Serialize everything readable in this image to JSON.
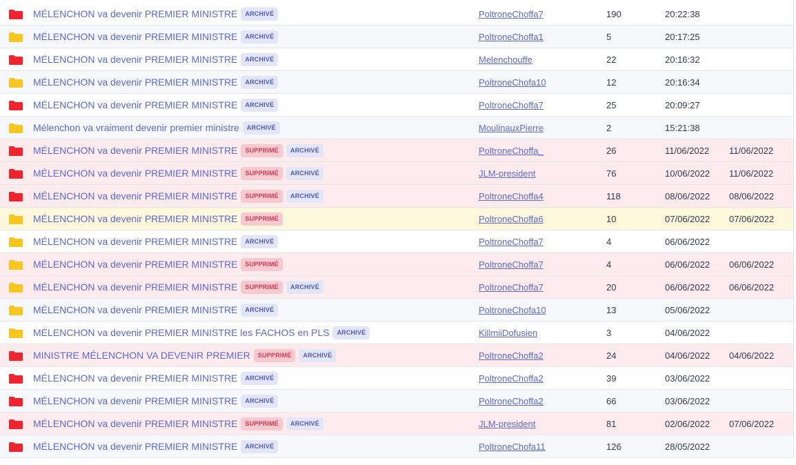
{
  "colors": {
    "folder_red": "#f0252e",
    "folder_yellow": "#f9c51e",
    "link": "#5b6ad0",
    "deleted_row": "#fdebee",
    "highlight_row": "#fdf7dc"
  },
  "labels": {
    "archived": "ARCHIVÉ",
    "deleted": "SUPPRIMÉ"
  },
  "topics": [
    {
      "title": "MÉLENCHON va devenir PREMIER MINISTRE",
      "folder": "red",
      "deleted": false,
      "archived": true,
      "bg": "white",
      "author": "PoltroneChoffa7",
      "replies": "190",
      "date": "20:22:38",
      "deleted_date": ""
    },
    {
      "title": "MÉLENCHON va devenir PREMIER MINISTRE",
      "folder": "yellow",
      "deleted": false,
      "archived": true,
      "bg": "alt",
      "author": "PoltroneChoffa1",
      "replies": "5",
      "date": "20:17:25",
      "deleted_date": ""
    },
    {
      "title": "MÉLENCHON va devenir PREMIER MINISTRE",
      "folder": "red",
      "deleted": false,
      "archived": true,
      "bg": "white",
      "author": "Melenchouffe",
      "replies": "22",
      "date": "20:16:32",
      "deleted_date": ""
    },
    {
      "title": "MÉLENCHON va devenir PREMIER MINISTRE",
      "folder": "yellow",
      "deleted": false,
      "archived": true,
      "bg": "alt",
      "author": "PoltroneChofa10",
      "replies": "12",
      "date": "20:16:34",
      "deleted_date": ""
    },
    {
      "title": "MÉLENCHON va devenir PREMIER MINISTRE",
      "folder": "red",
      "deleted": false,
      "archived": true,
      "bg": "white",
      "author": "PoltroneChoffa7",
      "replies": "25",
      "date": "20:09:27",
      "deleted_date": ""
    },
    {
      "title": "Mélenchon va vraiment devenir premier ministre",
      "folder": "yellow",
      "deleted": false,
      "archived": true,
      "bg": "alt",
      "author": "MoulinauxPierre",
      "replies": "2",
      "date": "15:21:38",
      "deleted_date": ""
    },
    {
      "title": "MÉLENCHON va devenir PREMIER MINISTRE",
      "folder": "red",
      "deleted": true,
      "archived": true,
      "bg": "deleted",
      "author": "PoltroneChoffa_",
      "replies": "26",
      "date": "11/06/2022",
      "deleted_date": "11/06/2022"
    },
    {
      "title": "MÉLENCHON va devenir PREMIER MINISTRE",
      "folder": "red",
      "deleted": true,
      "archived": true,
      "bg": "deleted",
      "author": "JLM-president",
      "replies": "76",
      "date": "10/06/2022",
      "deleted_date": "11/06/2022"
    },
    {
      "title": "MÉLENCHON va devenir PREMIER MINISTRE",
      "folder": "red",
      "deleted": true,
      "archived": true,
      "bg": "deleted",
      "author": "PoltroneChoffa4",
      "replies": "118",
      "date": "08/06/2022",
      "deleted_date": "08/06/2022"
    },
    {
      "title": "MÉLENCHON va devenir PREMIER MINISTRE",
      "folder": "yellow",
      "deleted": true,
      "archived": false,
      "bg": "highlight",
      "author": "PoltroneChoffa6",
      "replies": "10",
      "date": "07/06/2022",
      "deleted_date": "07/06/2022"
    },
    {
      "title": "MÉLENCHON va devenir PREMIER MINISTRE",
      "folder": "yellow",
      "deleted": false,
      "archived": true,
      "bg": "white",
      "author": "PoltroneChoffa7",
      "replies": "4",
      "date": "06/06/2022",
      "deleted_date": ""
    },
    {
      "title": "MÉLENCHON va devenir PREMIER MINISTRE",
      "folder": "yellow",
      "deleted": true,
      "archived": false,
      "bg": "deleted",
      "author": "PoltroneChoffa7",
      "replies": "4",
      "date": "06/06/2022",
      "deleted_date": "06/06/2022"
    },
    {
      "title": "MÉLENCHON va devenir PREMIER MINISTRE",
      "folder": "yellow",
      "deleted": true,
      "archived": true,
      "bg": "deleted",
      "author": "PoltroneChoffa7",
      "replies": "20",
      "date": "06/06/2022",
      "deleted_date": "06/06/2022"
    },
    {
      "title": "MÉLENCHON va devenir PREMIER MINISTRE",
      "folder": "yellow",
      "deleted": false,
      "archived": true,
      "bg": "alt",
      "author": "PoltroneChofa10",
      "replies": "13",
      "date": "05/06/2022",
      "deleted_date": ""
    },
    {
      "title": "MÉLENCHON va devenir PREMIER MINISTRE les FACHOS en PLS",
      "folder": "yellow",
      "deleted": false,
      "archived": true,
      "bg": "white",
      "author": "KillmiiDofusien",
      "replies": "3",
      "date": "04/06/2022",
      "deleted_date": ""
    },
    {
      "title": "MINISTRE MÉLENCHON VA DEVENIR PREMIER",
      "folder": "red",
      "deleted": true,
      "archived": true,
      "bg": "deleted",
      "author": "PoltroneChoffa2",
      "replies": "24",
      "date": "04/06/2022",
      "deleted_date": "04/06/2022"
    },
    {
      "title": "MÉLENCHON va devenir PREMIER MINISTRE",
      "folder": "red",
      "deleted": false,
      "archived": true,
      "bg": "white",
      "author": "PoltroneChoffa2",
      "replies": "39",
      "date": "03/06/2022",
      "deleted_date": ""
    },
    {
      "title": "MÉLENCHON va devenir PREMIER MINISTRE",
      "folder": "red",
      "deleted": false,
      "archived": true,
      "bg": "alt",
      "author": "PoltroneChoffa2",
      "replies": "66",
      "date": "03/06/2022",
      "deleted_date": ""
    },
    {
      "title": "MÉLENCHON va devenir PREMIER MINISTRE",
      "folder": "red",
      "deleted": true,
      "archived": true,
      "bg": "deleted",
      "author": "JLM-president",
      "replies": "81",
      "date": "02/06/2022",
      "deleted_date": "07/06/2022"
    },
    {
      "title": "MÉLENCHON va devenir PREMIER MINISTRE",
      "folder": "red",
      "deleted": false,
      "archived": true,
      "bg": "alt",
      "author": "PoltroneChofa11",
      "replies": "126",
      "date": "28/05/2022",
      "deleted_date": ""
    }
  ]
}
